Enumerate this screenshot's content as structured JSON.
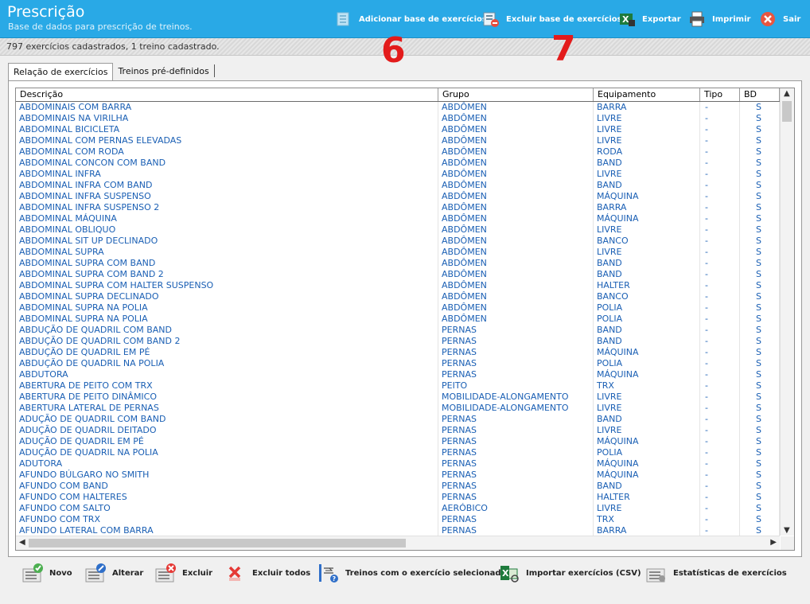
{
  "header": {
    "title": "Prescrição",
    "subtitle": "Base de dados para prescrição de treinos."
  },
  "toolbar": [
    {
      "id": "add-base",
      "label": "Adicionar base de exercícios",
      "icon": "add-database-icon"
    },
    {
      "id": "delete-base",
      "label": "Excluir base de exercícios",
      "icon": "delete-database-icon"
    },
    {
      "id": "export",
      "label": "Exportar",
      "icon": "excel-export-icon"
    },
    {
      "id": "print",
      "label": "Imprimir",
      "icon": "printer-icon"
    },
    {
      "id": "exit",
      "label": "Sair",
      "icon": "close-circle-icon"
    }
  ],
  "status": "797 exercícios cadastrados, 1 treino cadastrado.",
  "annotations": [
    "6",
    "7"
  ],
  "tabs": [
    {
      "label": "Relação de exercícios",
      "active": true
    },
    {
      "label": "Treinos pré-definidos",
      "active": false
    }
  ],
  "table": {
    "columns": [
      "Descrição",
      "Grupo",
      "Equipamento",
      "Tipo",
      "BD"
    ],
    "rows": [
      [
        "ABDOMINAIS COM BARRA",
        "ABDÔMEN",
        "BARRA",
        "-",
        "S"
      ],
      [
        "ABDOMINAIS NA VIRILHA",
        "ABDÔMEN",
        "LIVRE",
        "-",
        "S"
      ],
      [
        "ABDOMINAL BICICLETA",
        "ABDÔMEN",
        "LIVRE",
        "-",
        "S"
      ],
      [
        "ABDOMINAL COM PERNAS ELEVADAS",
        "ABDÔMEN",
        "LIVRE",
        "-",
        "S"
      ],
      [
        "ABDOMINAL COM RODA",
        "ABDÔMEN",
        "RODA",
        "-",
        "S"
      ],
      [
        "ABDOMINAL CONCON COM BAND",
        "ABDÔMEN",
        "BAND",
        "-",
        "S"
      ],
      [
        "ABDOMINAL INFRA",
        "ABDÔMEN",
        "LIVRE",
        "-",
        "S"
      ],
      [
        "ABDOMINAL INFRA COM BAND",
        "ABDÔMEN",
        "BAND",
        "-",
        "S"
      ],
      [
        "ABDOMINAL INFRA SUSPENSO",
        "ABDÔMEN",
        "MÁQUINA",
        "-",
        "S"
      ],
      [
        "ABDOMINAL INFRA SUSPENSO 2",
        "ABDÔMEN",
        "BARRA",
        "-",
        "S"
      ],
      [
        "ABDOMINAL MÁQUINA",
        "ABDÔMEN",
        "MÁQUINA",
        "-",
        "S"
      ],
      [
        "ABDOMINAL OBLIQUO",
        "ABDÔMEN",
        "LIVRE",
        "-",
        "S"
      ],
      [
        "ABDOMINAL SIT UP DECLINADO",
        "ABDÔMEN",
        "BANCO",
        "-",
        "S"
      ],
      [
        "ABDOMINAL SUPRA",
        "ABDÔMEN",
        "LIVRE",
        "-",
        "S"
      ],
      [
        "ABDOMINAL SUPRA COM BAND",
        "ABDÔMEN",
        "BAND",
        "-",
        "S"
      ],
      [
        "ABDOMINAL SUPRA COM BAND 2",
        "ABDÔMEN",
        "BAND",
        "-",
        "S"
      ],
      [
        "ABDOMINAL SUPRA COM HALTER SUSPENSO",
        "ABDÔMEN",
        "HALTER",
        "-",
        "S"
      ],
      [
        "ABDOMINAL SUPRA DECLINADO",
        "ABDÔMEN",
        "BANCO",
        "-",
        "S"
      ],
      [
        "ABDOMINAL SUPRA NA POLIA",
        "ABDÔMEN",
        "POLIA",
        "-",
        "S"
      ],
      [
        "ABDOMINAL SUPRA NA POLIA",
        "ABDÔMEN",
        "POLIA",
        "-",
        "S"
      ],
      [
        "ABDUÇÃO DE QUADRIL COM BAND",
        "PERNAS",
        "BAND",
        "-",
        "S"
      ],
      [
        "ABDUÇÃO DE QUADRIL COM BAND 2",
        "PERNAS",
        "BAND",
        "-",
        "S"
      ],
      [
        "ABDUÇÃO DE QUADRIL EM PÉ",
        "PERNAS",
        "MÁQUINA",
        "-",
        "S"
      ],
      [
        "ABDUÇÃO DE QUADRIL NA POLIA",
        "PERNAS",
        "POLIA",
        "-",
        "S"
      ],
      [
        "ABDUTORA",
        "PERNAS",
        "MÁQUINA",
        "-",
        "S"
      ],
      [
        "ABERTURA DE PEITO COM TRX",
        "PEITO",
        "TRX",
        "-",
        "S"
      ],
      [
        "ABERTURA DE PEITO DINÂMICO",
        "MOBILIDADE-ALONGAMENTO",
        "LIVRE",
        "-",
        "S"
      ],
      [
        "ABERTURA LATERAL DE PERNAS",
        "MOBILIDADE-ALONGAMENTO",
        "LIVRE",
        "-",
        "S"
      ],
      [
        "ADUÇÃO DE QUADRIL COM BAND",
        "PERNAS",
        "BAND",
        "-",
        "S"
      ],
      [
        "ADUÇÃO DE QUADRIL DEITADO",
        "PERNAS",
        "LIVRE",
        "-",
        "S"
      ],
      [
        "ADUÇÃO DE QUADRIL EM PÉ",
        "PERNAS",
        "MÁQUINA",
        "-",
        "S"
      ],
      [
        "ADUÇÃO DE QUADRIL NA POLIA",
        "PERNAS",
        "POLIA",
        "-",
        "S"
      ],
      [
        "ADUTORA",
        "PERNAS",
        "MÁQUINA",
        "-",
        "S"
      ],
      [
        "AFUNDO BÚLGARO NO SMITH",
        "PERNAS",
        "MÁQUINA",
        "-",
        "S"
      ],
      [
        "AFUNDO COM BAND",
        "PERNAS",
        "BAND",
        "-",
        "S"
      ],
      [
        "AFUNDO COM HALTERES",
        "PERNAS",
        "HALTER",
        "-",
        "S"
      ],
      [
        "AFUNDO COM SALTO",
        "AERÓBICO",
        "LIVRE",
        "-",
        "S"
      ],
      [
        "AFUNDO COM TRX",
        "PERNAS",
        "TRX",
        "-",
        "S"
      ],
      [
        "AFUNDO LATERAL COM BARRA",
        "PERNAS",
        "BARRA",
        "-",
        "S"
      ]
    ]
  },
  "bottom_buttons": [
    {
      "id": "new",
      "label": "Novo",
      "icon": "add-list-icon"
    },
    {
      "id": "edit",
      "label": "Alterar",
      "icon": "edit-list-icon"
    },
    {
      "id": "delete",
      "label": "Excluir",
      "icon": "delete-list-icon"
    },
    {
      "id": "delete-all",
      "label": "Excluir todos",
      "icon": "delete-all-icon"
    },
    {
      "id": "workouts-with",
      "label": "Treinos com o exercício selecionado",
      "icon": "workouts-query-icon"
    },
    {
      "id": "import",
      "label": "Importar exercícios (CSV)",
      "icon": "excel-import-icon"
    },
    {
      "id": "stats",
      "label": "Estatísticas de exercícios",
      "icon": "statistics-icon"
    }
  ],
  "colors": {
    "header": "#29a9e6",
    "row_text": "#1a5fb4",
    "annotation": "#e31b1b"
  }
}
